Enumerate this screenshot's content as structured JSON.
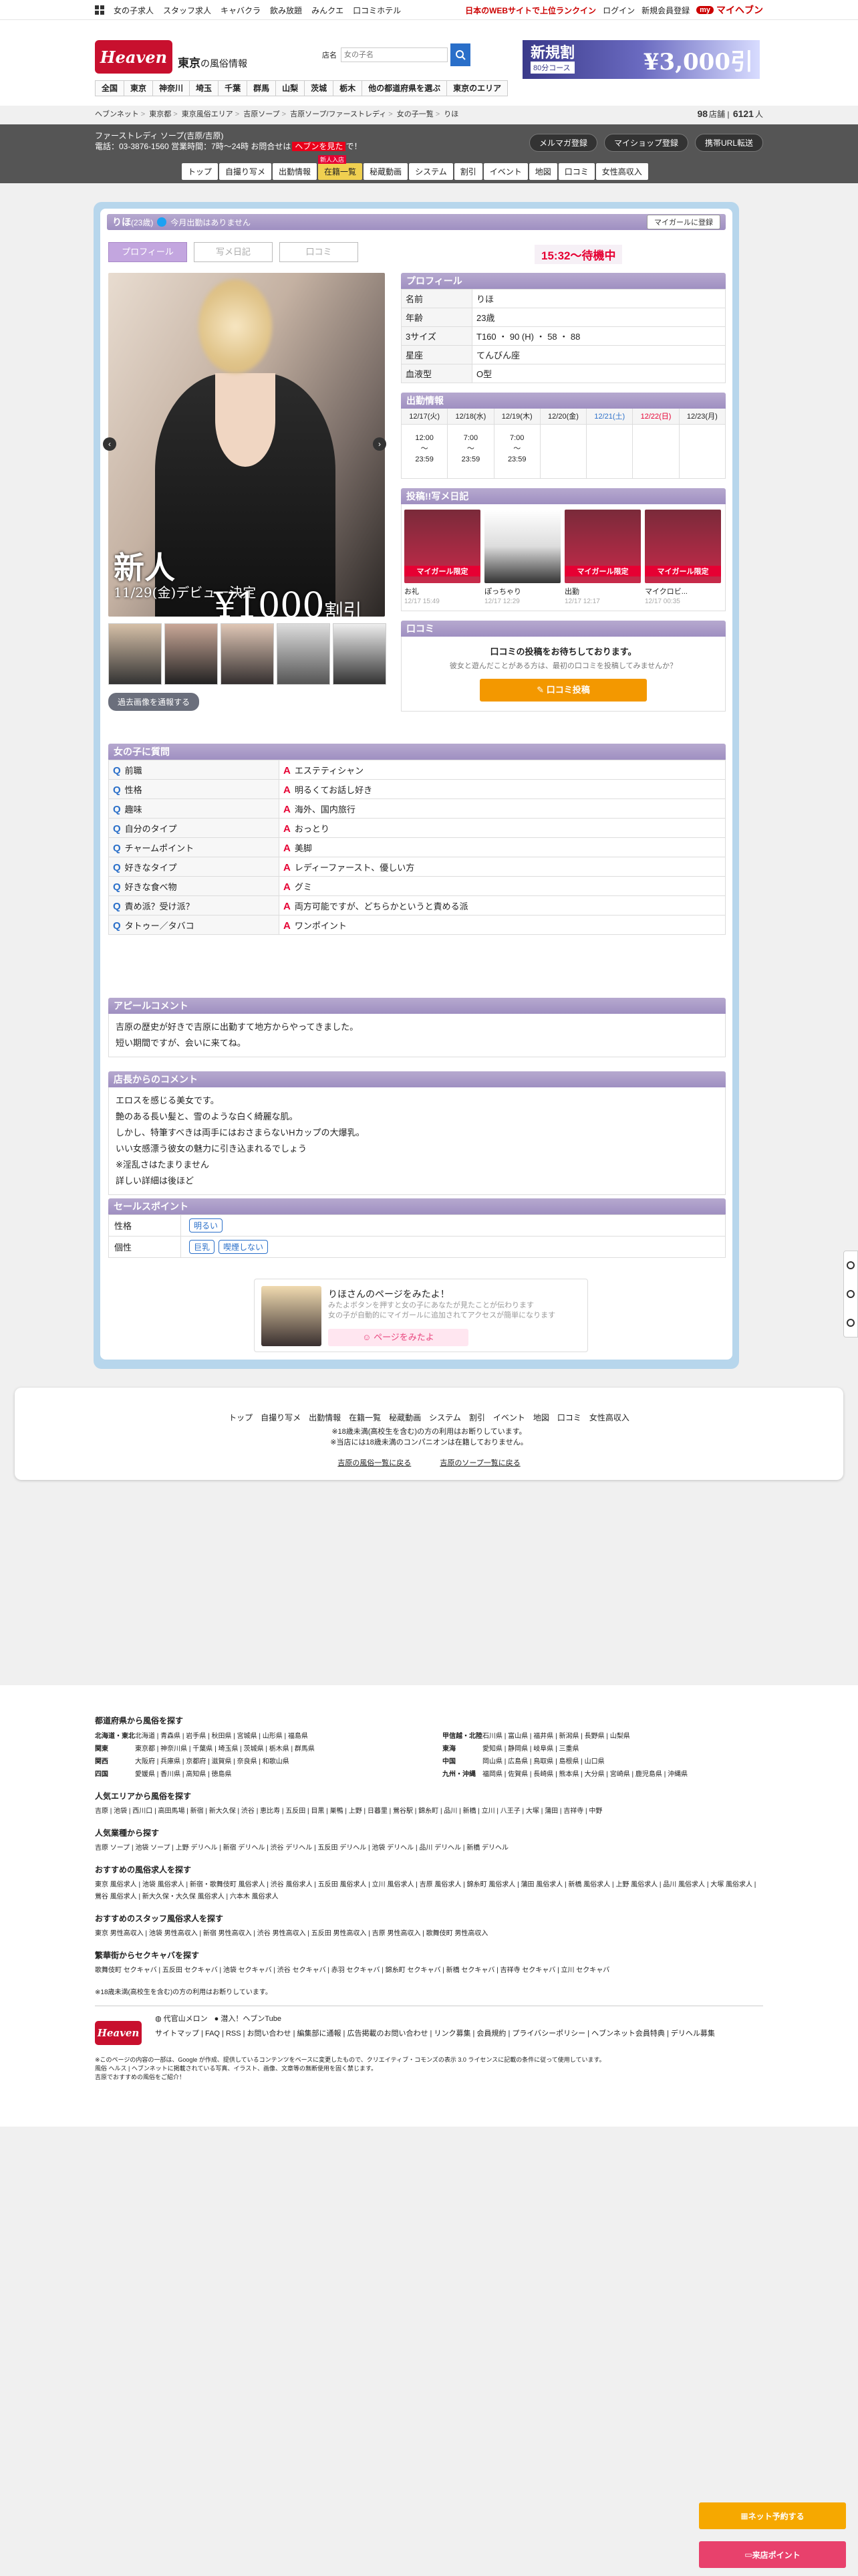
{
  "topbar": {
    "links": [
      "女の子求人",
      "スタッフ求人",
      "キャバクラ",
      "飲み放題",
      "みんクエ",
      "口コミホテル"
    ],
    "ranking_text": "日本のWEBサイトで上位ランクイン",
    "login": "ログイン",
    "register": "新規会員登録",
    "myheaven": "マイヘブン"
  },
  "header": {
    "logo_text": "Heaven",
    "area_title": "東京",
    "area_sub": "の風俗情報",
    "search_label": "店名",
    "search_placeholder": "女の子名",
    "banner_line1": "新規割",
    "banner_line2": "80分コース",
    "banner_price": "¥3,000引",
    "gnav": [
      "全国",
      "東京",
      "神奈川",
      "埼玉",
      "千葉",
      "群馬",
      "山梨",
      "茨城",
      "栃木",
      "他の都道府県を選ぶ",
      "東京のエリア"
    ]
  },
  "breadcrumb": [
    "ヘブンネット",
    "東京都",
    "東京風俗エリア",
    "吉原ソープ",
    "吉原ソープ/ファーストレディ",
    "女の子一覧",
    "りほ"
  ],
  "counts": {
    "shops": "98",
    "shops_unit": "店舗",
    "girls": "6121",
    "girls_unit": "人"
  },
  "shop": {
    "name": "ファーストレディ ソープ(吉原/吉原)",
    "tel": "電話：03-3876-1560 営業時間：7時〜24時 お問合せは",
    "now": "ヘブンを見た",
    "suffix": "で！",
    "buttons": [
      "メルマガ登録",
      "マイショップ登録",
      "携帯URL転送"
    ],
    "nav": [
      "トップ",
      "自撮り写メ",
      "出勤情報",
      "在籍一覧",
      "秘蔵動画",
      "システム",
      "割引",
      "イベント",
      "地図",
      "口コミ",
      "女性高収入"
    ],
    "nav_new": "新人入店"
  },
  "girl": {
    "name": "りほ",
    "age_label": "(23歳)",
    "tw_note": "今月出勤はありません",
    "mygirl_btn": "マイガールに登録",
    "tabs": [
      "プロフィール",
      "写メ日記",
      "口コミ"
    ],
    "status": "15:32〜待機中",
    "promo_new": "新人",
    "promo_debut": "11/29(金)デビュー決定",
    "promo_price": "¥1000",
    "promo_price_suffix": "割引",
    "prev_btn": "過去画像を通報する"
  },
  "profile": {
    "title": "プロフィール",
    "rows": [
      {
        "k": "名前",
        "v": "りほ"
      },
      {
        "k": "年齢",
        "v": "23歳"
      },
      {
        "k": "3サイズ",
        "v": "T160 ・ 90 (H) ・ 58 ・ 88"
      },
      {
        "k": "星座",
        "v": "てんびん座"
      },
      {
        "k": "血液型",
        "v": "O型"
      }
    ]
  },
  "schedule": {
    "title": "出勤情報",
    "days": [
      {
        "date": "12/17(火)",
        "time": [
          "12:00",
          "〜",
          "23:59"
        ],
        "cls": ""
      },
      {
        "date": "12/18(水)",
        "time": [
          "7:00",
          "〜",
          "23:59"
        ],
        "cls": ""
      },
      {
        "date": "12/19(木)",
        "time": [
          "7:00",
          "〜",
          "23:59"
        ],
        "cls": ""
      },
      {
        "date": "12/20(金)",
        "time": [
          "",
          "",
          ""
        ],
        "cls": ""
      },
      {
        "date": "12/21(土)",
        "time": [
          "",
          "",
          ""
        ],
        "cls": "sat"
      },
      {
        "date": "12/22(日)",
        "time": [
          "",
          "",
          ""
        ],
        "cls": "sun"
      },
      {
        "date": "12/23(月)",
        "time": [
          "",
          "",
          ""
        ],
        "cls": ""
      }
    ]
  },
  "diary": {
    "title": "投稿!!写メ日記",
    "posts": [
      {
        "tag": "マイガール限定",
        "title": "お礼",
        "date": "12/17 15:49"
      },
      {
        "tag": "",
        "title": "ぽっちゃり",
        "date": "12/17 12:29"
      },
      {
        "tag": "マイガール限定",
        "title": "出勤",
        "date": "12/17 12:17"
      },
      {
        "tag": "マイガール限定",
        "title": "マイクロビ...",
        "date": "12/17 00:35"
      }
    ]
  },
  "kuchikomi": {
    "title": "口コミ",
    "line1": "口コミの投稿をお待ちしております。",
    "line2": "彼女と遊んだことがある方は、最初の口コミを投稿してみませんか？",
    "btn": "口コミ投稿"
  },
  "qa": {
    "title": "女の子に質問",
    "rows": [
      {
        "q": "前職",
        "a": "エステティシャン"
      },
      {
        "q": "性格",
        "a": "明るくてお話し好き"
      },
      {
        "q": "趣味",
        "a": "海外、国内旅行"
      },
      {
        "q": "自分のタイプ",
        "a": "おっとり"
      },
      {
        "q": "チャームポイント",
        "a": "美脚"
      },
      {
        "q": "好きなタイプ",
        "a": "レディーファースト、優しい方"
      },
      {
        "q": "好きな食べ物",
        "a": "グミ"
      },
      {
        "q": "責め派？受け派？",
        "a": "両方可能ですが、どちらかというと責める派"
      },
      {
        "q": "タトゥー／タバコ",
        "a": "ワンポイント"
      }
    ]
  },
  "appeal": {
    "title": "アピールコメント",
    "lines": [
      "吉原の歴史が好きで吉原に出勤すて地方からやってきました。",
      "短い期間ですが、会いに来てね。"
    ]
  },
  "shop_comment": {
    "title": "店長からのコメント",
    "lines": [
      "エロスを感じる美女です。",
      "艶のある長い髪と、雪のような白く綺麗な肌。",
      "しかし、特筆すべきは両手にはおさまらないHカップの大爆乳。",
      "いい女感漂う彼女の魅力に引き込まれるでしょう",
      "※淫乱さはたまりません",
      "詳しい詳細は後ほど"
    ]
  },
  "sales": {
    "title": "セールスポイント",
    "rows": [
      {
        "k": "性格",
        "chips": [
          "明るい"
        ]
      },
      {
        "k": "個性",
        "chips": [
          "巨乳",
          "喫煙しない"
        ]
      }
    ]
  },
  "good": {
    "title": "りほさんのページをみたよ！",
    "desc": [
      "みたよボタンを押すと女の子にあなたが見たことが伝わります",
      "女の子が自動的にマイガールに追加されてアクセスが簡単になります"
    ],
    "btn": "ページをみたよ"
  },
  "footnav": {
    "links": [
      "トップ",
      "自撮り写メ",
      "出勤情報",
      "在籍一覧",
      "秘蔵動画",
      "システム",
      "割引",
      "イベント",
      "地図",
      "口コミ",
      "女性高収入"
    ],
    "note1": "※18歳未満(高校生を含む)の方の利用はお断りしています。",
    "note2": "※当店には18歳未満のコンパニオンは在籍しておりません。",
    "back": [
      "吉原の風俗一覧に戻る",
      "吉原のソープ一覧に戻る"
    ]
  },
  "sitefoot": {
    "pref_title": "都道府県から風俗を探す",
    "pref_left": [
      {
        "r": "北海道・東北",
        "p": "北海道 | 青森県 | 岩手県 | 秋田県 | 宮城県 | 山形県 | 福島県"
      },
      {
        "r": "関東",
        "p": "東京都 | 神奈川県 | 千葉県 | 埼玉県 | 茨城県 | 栃木県 | 群馬県"
      },
      {
        "r": "関西",
        "p": "大阪府 | 兵庫県 | 京都府 | 滋賀県 | 奈良県 | 和歌山県"
      },
      {
        "r": "四国",
        "p": "愛媛県 | 香川県 | 高知県 | 徳島県"
      }
    ],
    "pref_right": [
      {
        "r": "甲信越・北陸",
        "p": "石川県 | 富山県 | 福井県 | 新潟県 | 長野県 | 山梨県"
      },
      {
        "r": "東海",
        "p": "愛知県 | 静岡県 | 岐阜県 | 三重県"
      },
      {
        "r": "中国",
        "p": "岡山県 | 広島県 | 鳥取県 | 島根県 | 山口県"
      },
      {
        "r": "九州・沖縄",
        "p": "福岡県 | 佐賀県 | 長崎県 | 熊本県 | 大分県 | 宮崎県 | 鹿児島県 | 沖縄県"
      }
    ],
    "area_title": "人気エリアから風俗を探す",
    "area_links": "吉原 | 池袋 | 西川口 | 高田馬場 | 新宿 | 新大久保 | 渋谷 | 恵比寿 | 五反田 | 目黒 | 巣鴨 | 上野 | 日暮里 | 鶯谷駅 | 錦糸町 | 品川 | 新橋 | 立川 | 八王子 | 大塚 | 蒲田 | 吉祥寺 | 中野",
    "gyoushu_title": "人気業種から探す",
    "gyoushu_links": "吉原 ソープ | 池袋 ソープ | 上野 デリヘル | 新宿 デリヘル | 渋谷 デリヘル | 五反田 デリヘル | 池袋 デリヘル | 品川 デリヘル | 新橋 デリヘル",
    "job_title": "おすすめの風俗求人を探す",
    "job_links": "東京 風俗求人 | 池袋 風俗求人 | 新宿・歌舞伎町 風俗求人 | 渋谷 風俗求人 | 五反田 風俗求人 | 立川 風俗求人 | 吉原 風俗求人 | 錦糸町 風俗求人 | 蒲田 風俗求人 | 新橋 風俗求人 | 上野 風俗求人 | 品川 風俗求人 | 大塚 風俗求人 | 鶯谷 風俗求人 | 新大久保・大久保 風俗求人 | 六本木 風俗求人",
    "staff_title": "おすすめのスタッフ風俗求人を探す",
    "staff_links": "東京 男性高収入 | 池袋 男性高収入 | 新宿 男性高収入 | 渋谷 男性高収入 | 五反田 男性高収入 | 吉原 男性高収入 | 歌舞伎町 男性高収入",
    "caba_title": "繁華街からセクキャバを探す",
    "caba_links": "歌舞伎町 セクキャバ | 五反田 セクキャバ | 池袋 セクキャバ | 渋谷 セクキャバ | 赤羽 セクキャバ | 錦糸町 セクキャバ | 新橋 セクキャバ | 吉祥寺 セクキャバ | 立川 セクキャバ",
    "age_note": "※18歳未満(高校生を含む)の方の利用はお断りしています。",
    "bottom1": "代官山メロン",
    "bottom2": "潜入！ヘブンTube",
    "links": "サイトマップ | FAQ | RSS | お問い合わせ | 編集部に通報 | 広告掲載のお問い合わせ | リンク募集 | 会員規約 | プライバシーポリシー | ヘブンネット会員特典 | デリヘル募集",
    "copyright": "※このページの内容の一部は、Google が作成、提供しているコンテンツをベースに変更したもので、クリエイティブ・コモンズの表示 3.0 ライセンスに記載の条件に従って使用しています。",
    "copyright2": "風俗 ヘルス | ヘブンネットに掲載されている写真、イラスト、画像、文章等の無断使用を固く禁じます。",
    "copyright3": "吉原でおすすめの風俗をご紹介！"
  },
  "floating": {
    "point_btn": "ネット予約する",
    "pt_btn": "来店ポイント"
  }
}
